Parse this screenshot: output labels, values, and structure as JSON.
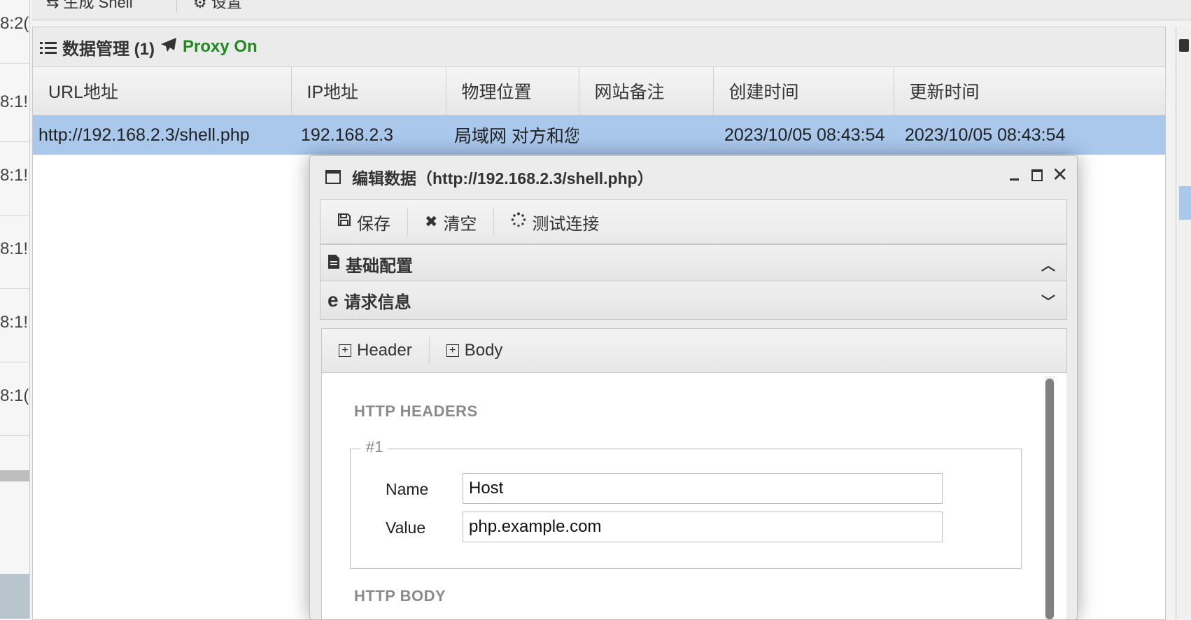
{
  "left_timestamps": [
    "8:2(",
    "8:1!",
    "8:1!",
    "8:1!",
    "8:1!",
    "8:1("
  ],
  "top_toolbar": {
    "generate_shell": "生成 Shell",
    "settings": "设置"
  },
  "panel": {
    "title": "数据管理 (1)",
    "proxy_status": "Proxy On",
    "proxy_color": "#1f8a1f",
    "columns": [
      "URL地址",
      "IP地址",
      "物理位置",
      "网站备注",
      "创建时间",
      "更新时间"
    ],
    "rows": [
      {
        "url": "http://192.168.2.3/shell.php",
        "ip": "192.168.2.3",
        "location": "局域网 对方和您f",
        "note": "",
        "created": "2023/10/05 08:43:54",
        "updated": "2023/10/05 08:43:54"
      }
    ],
    "selected_row_color": "#a9c8ec"
  },
  "dialog": {
    "title": "编辑数据（http://192.168.2.3/shell.php）",
    "toolbar": {
      "save": "保存",
      "clear": "清空",
      "test": "测试连接"
    },
    "sections": {
      "basic": "基础配置",
      "request": "请求信息"
    },
    "tabs": {
      "header": "Header",
      "body": "Body"
    },
    "http_headers_title": "HTTP HEADERS",
    "header_group": {
      "legend": "#1",
      "name_label": "Name",
      "name_value": "Host",
      "value_label": "Value",
      "value_value": "php.example.com"
    },
    "http_body_title": "HTTP BODY"
  }
}
